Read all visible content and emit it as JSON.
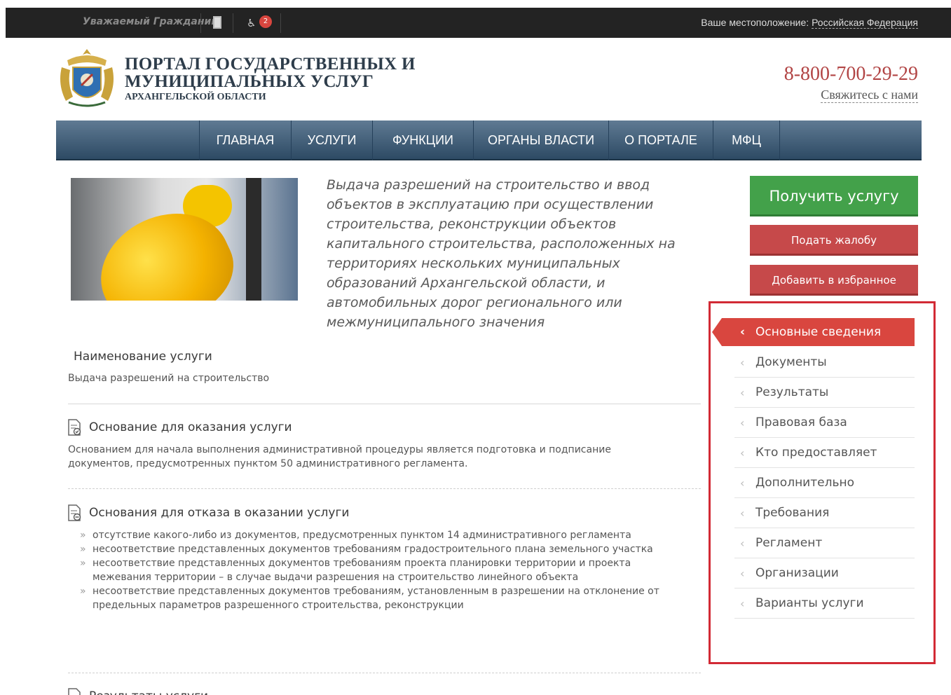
{
  "topbar": {
    "favorites_label": "Уважаемый Гражданин",
    "notification_count": "2",
    "location_label": "Ваше местоположение:",
    "location_value": "Российская Федерация"
  },
  "header": {
    "title_line1": "ПОРТАЛ ГОСУДАРСТВЕННЫХ И",
    "title_line2": "МУНИЦИПАЛЬНЫХ УСЛУГ",
    "subtitle": "АРХАНГЕЛЬСКОЙ ОБЛАСТИ",
    "phone": "8-800-700-29-29",
    "contact_link": "Свяжитесь с нами"
  },
  "nav": {
    "items": [
      {
        "label": "ГЛАВНАЯ"
      },
      {
        "label": "УСЛУГИ"
      },
      {
        "label": "ФУНКЦИИ"
      },
      {
        "label": "ОРГАНЫ ВЛАСТИ"
      },
      {
        "label": "О ПОРТАЛЕ"
      },
      {
        "label": "МФЦ"
      }
    ]
  },
  "service": {
    "title": "Выдача разрешений на строительство и ввод объектов в эксплуатацию при осуществлении строительства, реконструкции объектов капитального строительства, расположенных на территориях нескольких муниципальных образований Архангельской области, и автомобильных дорог регионального или межмуниципального значения"
  },
  "actions": {
    "get_service": "Получить услугу",
    "complain": "Подать жалобу",
    "add_favorite": "Добавить в избранное"
  },
  "side_menu": {
    "active": "Основные сведения",
    "items": [
      {
        "label": "Документы"
      },
      {
        "label": "Результаты"
      },
      {
        "label": "Правовая база"
      },
      {
        "label": "Кто предоставляет"
      },
      {
        "label": "Дополнительно"
      },
      {
        "label": "Требования"
      },
      {
        "label": "Регламент"
      },
      {
        "label": "Организации"
      },
      {
        "label": "Варианты услуги"
      }
    ]
  },
  "content": {
    "name_heading": "Наименование услуги",
    "name_value": "Выдача разрешений на строительство",
    "basis_heading": "Основание для оказания услуги",
    "basis_text": "Основанием для начала выполнения административной процедуры является подготовка и подписание документов, предусмотренных пунктом 50 административного регламента.",
    "refusal_heading": "Основания для отказа в оказании услуги",
    "refusal_items": [
      {
        "text": "отсутствие какого-либо из документов, предусмотренных пунктом 14 административного регламента"
      },
      {
        "text": "несоответствие представленных документов требованиям градостроительного плана земельного участка"
      },
      {
        "text": "несоответствие представленных документов требованиям проекта планировки территории и проекта межевания территории – в случае выдачи разрешения на строительство линейного объекта"
      },
      {
        "text": "несоответствие представленных документов требованиям, установленным в разрешении на отклонение от предельных параметров разрешенного строительства, реконструкции"
      }
    ],
    "results_heading": "Результаты услуги"
  }
}
